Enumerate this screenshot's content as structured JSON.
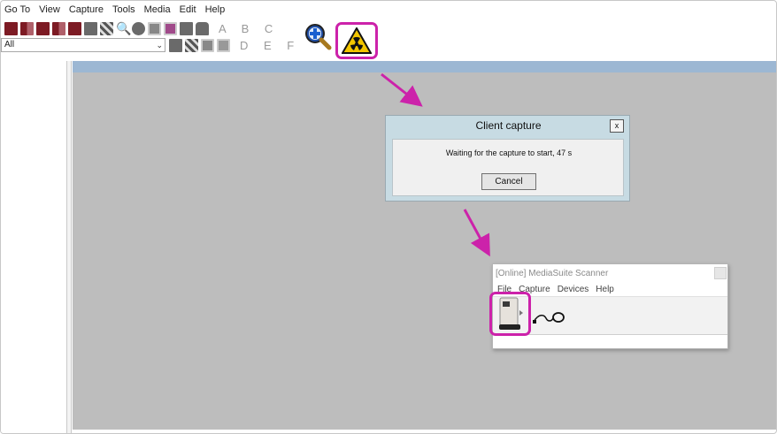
{
  "menubar": {
    "items": [
      "Go To",
      "View",
      "Capture",
      "Tools",
      "Media",
      "Edit",
      "Help"
    ]
  },
  "toolbar": {
    "select_value": "All",
    "letters_row1": "A B C",
    "letters_row2": "D E F",
    "highlight_color": "#cc22aa"
  },
  "dialog": {
    "title": "Client capture",
    "close_label": "x",
    "message": "Waiting for the capture to start, 47 s",
    "cancel_label": "Cancel"
  },
  "scanner_window": {
    "title": "[Online] MediaSuite Scanner",
    "menu": [
      "File",
      "Capture",
      "Devices",
      "Help"
    ]
  },
  "colors": {
    "workspace": "#bdbdbd",
    "header_strip": "#9cb7d3",
    "dialog_frame": "#c7dbe3",
    "arrow": "#cc22aa"
  }
}
